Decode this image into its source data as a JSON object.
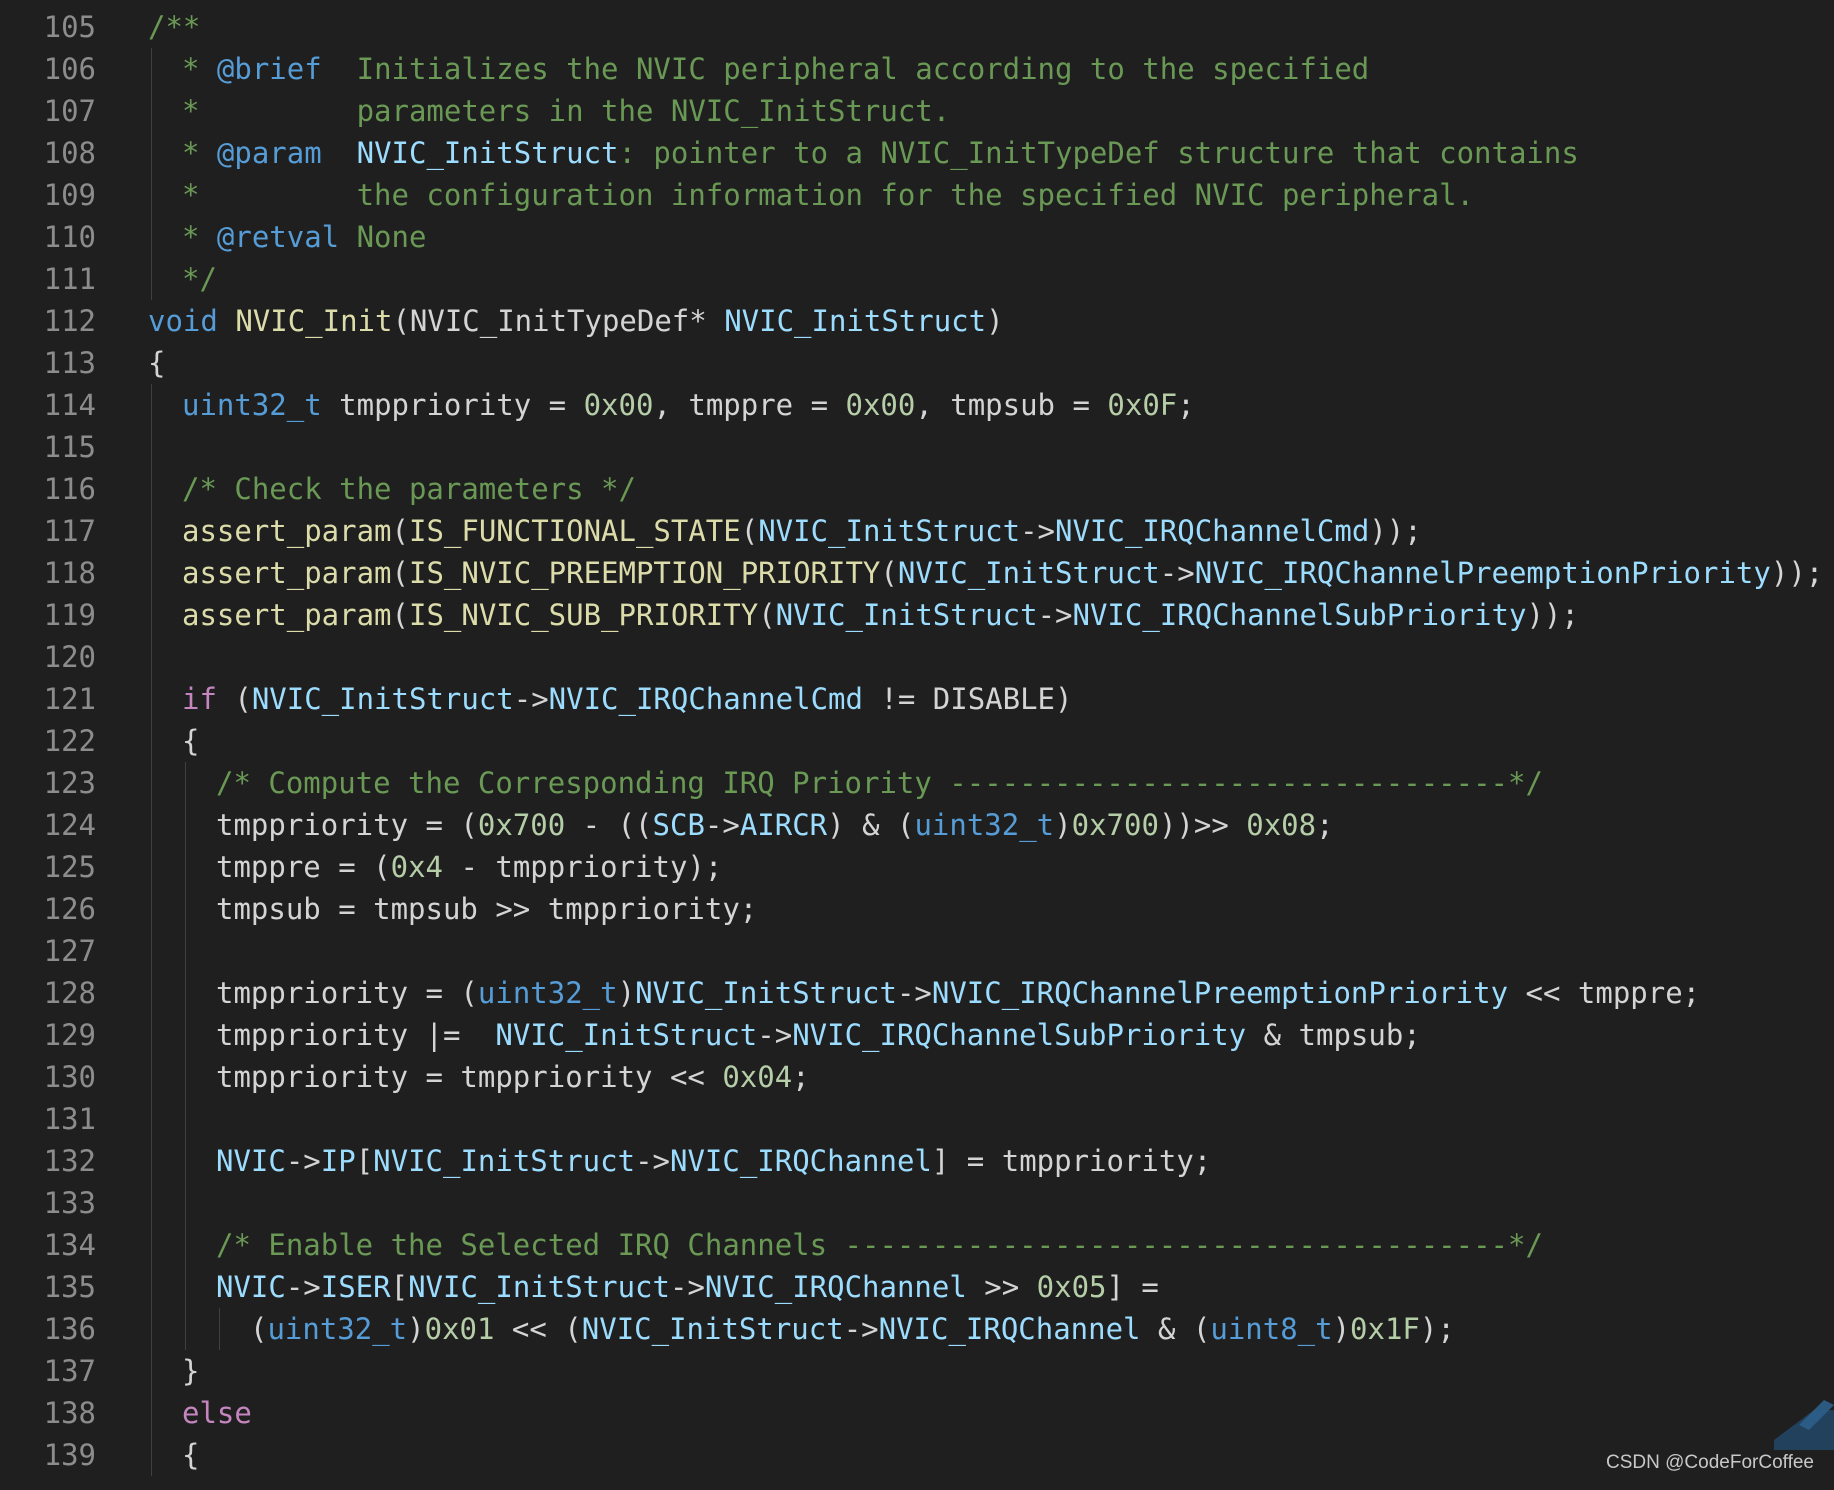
{
  "editor": {
    "watermark": "CSDN @CodeForCoffee",
    "lines": [
      {
        "n": "105",
        "indent": 0,
        "tokens": [
          [
            "/**",
            "c"
          ]
        ]
      },
      {
        "n": "106",
        "indent": 1,
        "tokens": [
          [
            "* ",
            "c"
          ],
          [
            "@brief",
            "tag"
          ],
          [
            "  Initializes the NVIC peripheral according to the specified",
            "c"
          ]
        ]
      },
      {
        "n": "107",
        "indent": 1,
        "tokens": [
          [
            "*         parameters in the NVIC_InitStruct.",
            "c"
          ]
        ]
      },
      {
        "n": "108",
        "indent": 1,
        "tokens": [
          [
            "* ",
            "c"
          ],
          [
            "@param",
            "tag"
          ],
          [
            "  ",
            "c"
          ],
          [
            "NVIC_InitStruct",
            "var"
          ],
          [
            ": pointer to a NVIC_InitTypeDef structure that contains",
            "c"
          ]
        ]
      },
      {
        "n": "109",
        "indent": 1,
        "tokens": [
          [
            "*         the configuration information for the specified NVIC peripheral.",
            "c"
          ]
        ]
      },
      {
        "n": "110",
        "indent": 1,
        "tokens": [
          [
            "* ",
            "c"
          ],
          [
            "@retval",
            "tag"
          ],
          [
            " None",
            "c"
          ]
        ]
      },
      {
        "n": "111",
        "indent": 1,
        "tokens": [
          [
            "*/",
            "c"
          ]
        ]
      },
      {
        "n": "112",
        "indent": 0,
        "tokens": [
          [
            "void",
            "kw"
          ],
          [
            " ",
            "plain"
          ],
          [
            "NVIC_Init",
            "fn"
          ],
          [
            "(NVIC_InitTypeDef* ",
            "plain"
          ],
          [
            "NVIC_InitStruct",
            "var"
          ],
          [
            ")",
            "plain"
          ]
        ]
      },
      {
        "n": "113",
        "indent": 0,
        "tokens": [
          [
            "{",
            "plain"
          ]
        ]
      },
      {
        "n": "114",
        "indent": 1,
        "tokens": [
          [
            "uint32_t",
            "kw"
          ],
          [
            " tmppriority = ",
            "plain"
          ],
          [
            "0x00",
            "num"
          ],
          [
            ", tmppre = ",
            "plain"
          ],
          [
            "0x00",
            "num"
          ],
          [
            ", tmpsub = ",
            "plain"
          ],
          [
            "0x0F",
            "num"
          ],
          [
            ";",
            "plain"
          ]
        ]
      },
      {
        "n": "115",
        "indent": 1,
        "tokens": []
      },
      {
        "n": "116",
        "indent": 1,
        "tokens": [
          [
            "/* Check the parameters */",
            "c"
          ]
        ]
      },
      {
        "n": "117",
        "indent": 1,
        "tokens": [
          [
            "assert_param",
            "fn"
          ],
          [
            "(",
            "plain"
          ],
          [
            "IS_FUNCTIONAL_STATE",
            "fn"
          ],
          [
            "(",
            "plain"
          ],
          [
            "NVIC_InitStruct",
            "var"
          ],
          [
            "->",
            "plain"
          ],
          [
            "NVIC_IRQChannelCmd",
            "var"
          ],
          [
            "));",
            "plain"
          ]
        ]
      },
      {
        "n": "118",
        "indent": 1,
        "tokens": [
          [
            "assert_param",
            "fn"
          ],
          [
            "(",
            "plain"
          ],
          [
            "IS_NVIC_PREEMPTION_PRIORITY",
            "fn"
          ],
          [
            "(",
            "plain"
          ],
          [
            "NVIC_InitStruct",
            "var"
          ],
          [
            "->",
            "plain"
          ],
          [
            "NVIC_IRQChannelPreemptionPriority",
            "var"
          ],
          [
            "));",
            "plain"
          ]
        ]
      },
      {
        "n": "119",
        "indent": 1,
        "tokens": [
          [
            "assert_param",
            "fn"
          ],
          [
            "(",
            "plain"
          ],
          [
            "IS_NVIC_SUB_PRIORITY",
            "fn"
          ],
          [
            "(",
            "plain"
          ],
          [
            "NVIC_InitStruct",
            "var"
          ],
          [
            "->",
            "plain"
          ],
          [
            "NVIC_IRQChannelSubPriority",
            "var"
          ],
          [
            "));",
            "plain"
          ]
        ]
      },
      {
        "n": "120",
        "indent": 1,
        "tokens": []
      },
      {
        "n": "121",
        "indent": 1,
        "tokens": [
          [
            "if",
            "ctl"
          ],
          [
            " (",
            "plain"
          ],
          [
            "NVIC_InitStruct",
            "var"
          ],
          [
            "->",
            "plain"
          ],
          [
            "NVIC_IRQChannelCmd",
            "var"
          ],
          [
            " != DISABLE)",
            "plain"
          ]
        ]
      },
      {
        "n": "122",
        "indent": 1,
        "tokens": [
          [
            "{",
            "plain"
          ]
        ]
      },
      {
        "n": "123",
        "indent": 2,
        "tokens": [
          [
            "/* Compute the Corresponding IRQ Priority --------------------------------*/",
            "c"
          ]
        ]
      },
      {
        "n": "124",
        "indent": 2,
        "tokens": [
          [
            "tmppriority = (",
            "plain"
          ],
          [
            "0x700",
            "num"
          ],
          [
            " - ((",
            "plain"
          ],
          [
            "SCB",
            "var"
          ],
          [
            "->",
            "plain"
          ],
          [
            "AIRCR",
            "var"
          ],
          [
            ") & (",
            "plain"
          ],
          [
            "uint32_t",
            "kw"
          ],
          [
            ")",
            "plain"
          ],
          [
            "0x700",
            "num"
          ],
          [
            "))>> ",
            "plain"
          ],
          [
            "0x08",
            "num"
          ],
          [
            ";",
            "plain"
          ]
        ]
      },
      {
        "n": "125",
        "indent": 2,
        "tokens": [
          [
            "tmppre = (",
            "plain"
          ],
          [
            "0x4",
            "num"
          ],
          [
            " - tmppriority);",
            "plain"
          ]
        ]
      },
      {
        "n": "126",
        "indent": 2,
        "tokens": [
          [
            "tmpsub = tmpsub >> tmppriority;",
            "plain"
          ]
        ]
      },
      {
        "n": "127",
        "indent": 2,
        "tokens": []
      },
      {
        "n": "128",
        "indent": 2,
        "tokens": [
          [
            "tmppriority = (",
            "plain"
          ],
          [
            "uint32_t",
            "kw"
          ],
          [
            ")",
            "plain"
          ],
          [
            "NVIC_InitStruct",
            "var"
          ],
          [
            "->",
            "plain"
          ],
          [
            "NVIC_IRQChannelPreemptionPriority",
            "var"
          ],
          [
            " << tmppre;",
            "plain"
          ]
        ]
      },
      {
        "n": "129",
        "indent": 2,
        "tokens": [
          [
            "tmppriority |=  ",
            "plain"
          ],
          [
            "NVIC_InitStruct",
            "var"
          ],
          [
            "->",
            "plain"
          ],
          [
            "NVIC_IRQChannelSubPriority",
            "var"
          ],
          [
            " & tmpsub;",
            "plain"
          ]
        ]
      },
      {
        "n": "130",
        "indent": 2,
        "tokens": [
          [
            "tmppriority = tmppriority << ",
            "plain"
          ],
          [
            "0x04",
            "num"
          ],
          [
            ";",
            "plain"
          ]
        ]
      },
      {
        "n": "131",
        "indent": 2,
        "tokens": []
      },
      {
        "n": "132",
        "indent": 2,
        "tokens": [
          [
            "NVIC",
            "var"
          ],
          [
            "->",
            "plain"
          ],
          [
            "IP",
            "var"
          ],
          [
            "[",
            "plain"
          ],
          [
            "NVIC_InitStruct",
            "var"
          ],
          [
            "->",
            "plain"
          ],
          [
            "NVIC_IRQChannel",
            "var"
          ],
          [
            "] = tmppriority;",
            "plain"
          ]
        ]
      },
      {
        "n": "133",
        "indent": 2,
        "tokens": []
      },
      {
        "n": "134",
        "indent": 2,
        "tokens": [
          [
            "/* Enable the Selected IRQ Channels --------------------------------------*/",
            "c"
          ]
        ]
      },
      {
        "n": "135",
        "indent": 2,
        "tokens": [
          [
            "NVIC",
            "var"
          ],
          [
            "->",
            "plain"
          ],
          [
            "ISER",
            "var"
          ],
          [
            "[",
            "plain"
          ],
          [
            "NVIC_InitStruct",
            "var"
          ],
          [
            "->",
            "plain"
          ],
          [
            "NVIC_IRQChannel",
            "var"
          ],
          [
            " >> ",
            "plain"
          ],
          [
            "0x05",
            "num"
          ],
          [
            "] =",
            "plain"
          ]
        ]
      },
      {
        "n": "136",
        "indent": 3,
        "tokens": [
          [
            "(",
            "plain"
          ],
          [
            "uint32_t",
            "kw"
          ],
          [
            ")",
            "plain"
          ],
          [
            "0x01",
            "num"
          ],
          [
            " << (",
            "plain"
          ],
          [
            "NVIC_InitStruct",
            "var"
          ],
          [
            "->",
            "plain"
          ],
          [
            "NVIC_IRQChannel",
            "var"
          ],
          [
            " & (",
            "plain"
          ],
          [
            "uint8_t",
            "kw"
          ],
          [
            ")",
            "plain"
          ],
          [
            "0x1F",
            "num"
          ],
          [
            ");",
            "plain"
          ]
        ]
      },
      {
        "n": "137",
        "indent": 1,
        "tokens": [
          [
            "}",
            "plain"
          ]
        ]
      },
      {
        "n": "138",
        "indent": 1,
        "tokens": [
          [
            "else",
            "ctl"
          ]
        ]
      },
      {
        "n": "139",
        "indent": 1,
        "tokens": [
          [
            "{",
            "plain"
          ]
        ]
      }
    ]
  }
}
